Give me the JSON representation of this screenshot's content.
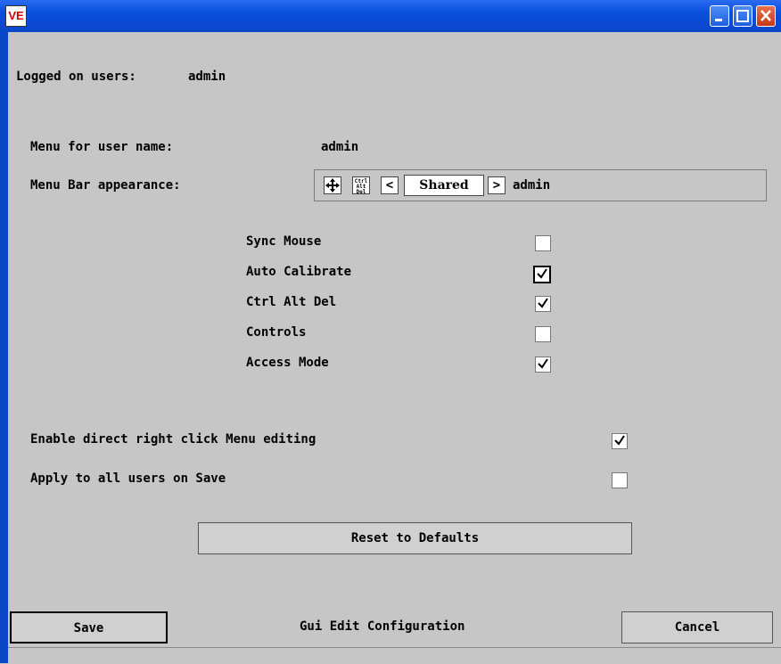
{
  "window": {
    "icon_text": "VE"
  },
  "logged_on": {
    "label": "Logged on users:",
    "value": "admin"
  },
  "menu_for": {
    "label": "Menu for user name:",
    "value": "admin"
  },
  "menu_bar": {
    "label": "Menu Bar appearance:",
    "icon_move": "move-icon",
    "icon_cad": "Ctrl Alt Del",
    "prev": "<",
    "mode": "Shared",
    "next": ">",
    "user": "admin"
  },
  "options": [
    {
      "label": "Sync Mouse",
      "checked": false
    },
    {
      "label": "Auto Calibrate",
      "checked": true
    },
    {
      "label": "Ctrl Alt Del",
      "checked": true
    },
    {
      "label": "Controls",
      "checked": false
    },
    {
      "label": "Access Mode",
      "checked": true
    }
  ],
  "enable_rc": {
    "label": "Enable direct right click Menu editing",
    "checked": true
  },
  "apply_all": {
    "label": "Apply to all users on Save",
    "checked": false
  },
  "reset_label": "Reset to Defaults",
  "footer": {
    "save_label": "Save",
    "title": "Gui Edit Configuration",
    "cancel_label": "Cancel"
  }
}
